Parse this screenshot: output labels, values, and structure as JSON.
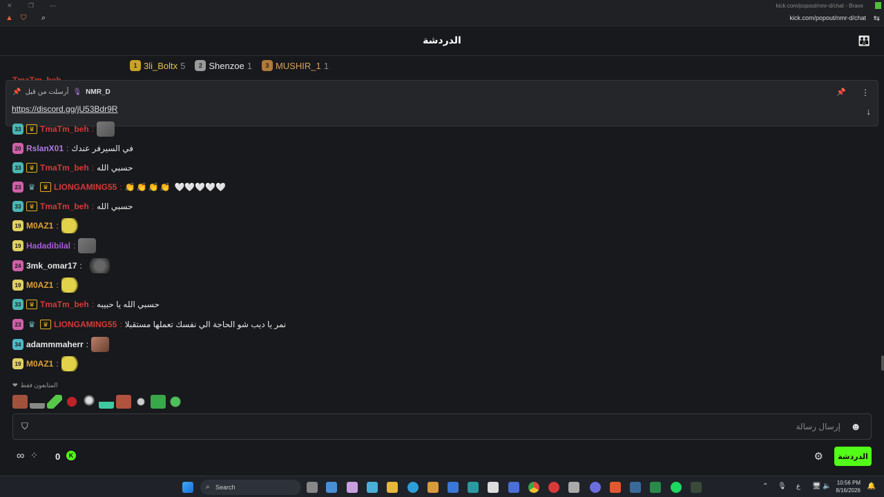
{
  "browser": {
    "title": "kick.com/popout/nmr-d/chat - Brave",
    "url": "kick.com/popout/nmr-d/chat"
  },
  "header": {
    "title": "الدردشة"
  },
  "leaderboard": [
    {
      "rank": "1",
      "name": "3li_Boltx",
      "count": "5"
    },
    {
      "rank": "2",
      "name": "Shenzoe",
      "count": "1"
    },
    {
      "rank": "3",
      "name": "MUSHIR_1",
      "count": "1"
    }
  ],
  "pinned": {
    "label": "أرسلت من قبل",
    "author": "NMR_D",
    "link": "https://discord.gg/jU53Bdr9R"
  },
  "ghost_user": "TmaTm_beh",
  "messages": [
    {
      "badge": "33",
      "user": "TmaTm_beh",
      "text": ""
    },
    {
      "badge": "20",
      "user": "RslanX01",
      "text": "في السيرفر عندك"
    },
    {
      "badge": "33",
      "user": "TmaTm_beh",
      "text": "حسبي الله"
    },
    {
      "badge": "23",
      "user": "LIONGAMING55",
      "text": ""
    },
    {
      "badge": "33",
      "user": "TmaTm_beh",
      "text": "حسبي الله"
    },
    {
      "badge": "19",
      "user": "M0AZ1",
      "text": ""
    },
    {
      "badge": "19",
      "user": "Hadadibilal",
      "text": ""
    },
    {
      "badge": "24",
      "user": "3mk_omar17",
      "text": ""
    },
    {
      "badge": "19",
      "user": "M0AZ1",
      "text": ""
    },
    {
      "badge": "33",
      "user": "TmaTm_beh",
      "text": "حسبي الله يا حبيبه"
    },
    {
      "badge": "23",
      "user": "LIONGAMING55",
      "text": "نمر يا ديب شو الحاجة الي نفسك تعملها مستقبلا"
    },
    {
      "badge": "34",
      "user": "adammmaherr",
      "text": ""
    },
    {
      "badge": "19",
      "user": "M0AZ1",
      "text": ""
    }
  ],
  "followers_label": "المتابعون فقط",
  "composer": {
    "placeholder": "إرسال رسالة"
  },
  "bottombar": {
    "points": "0",
    "chat_button": "الدردشة"
  },
  "taskbar": {
    "search": "Search",
    "time": "10:56 PM",
    "date": "8/16/2026",
    "lang": "ع"
  }
}
